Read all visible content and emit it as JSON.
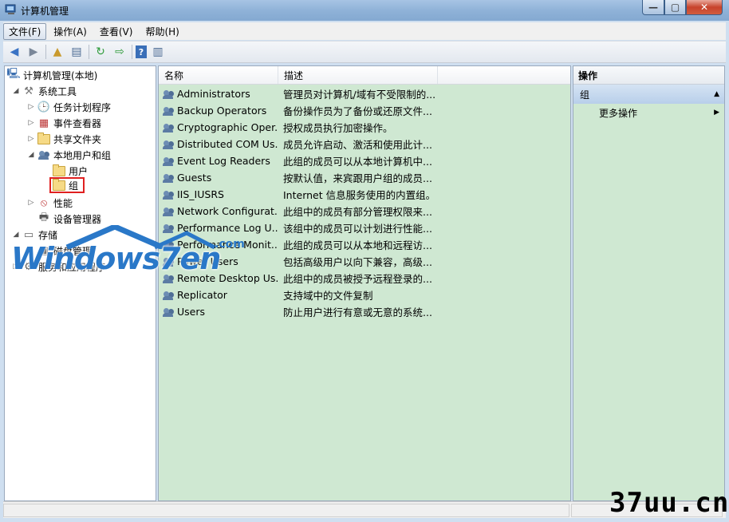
{
  "window": {
    "title": "计算机管理",
    "controls": {
      "min": "—",
      "max": "▢",
      "close": "✕"
    }
  },
  "menubar": [
    {
      "label": "文件(F)"
    },
    {
      "label": "操作(A)"
    },
    {
      "label": "查看(V)"
    },
    {
      "label": "帮助(H)"
    }
  ],
  "tree": {
    "root": "计算机管理(本地)",
    "system_tools": "系统工具",
    "task_scheduler": "任务计划程序",
    "event_viewer": "事件查看器",
    "shared_folders": "共享文件夹",
    "local_users_groups": "本地用户和组",
    "users": "用户",
    "groups": "组",
    "performance": "性能",
    "device_manager": "设备管理器",
    "storage": "存储",
    "disk_management": "磁盘管理",
    "services_apps": "服务和应用程序"
  },
  "list": {
    "columns": [
      "名称",
      "描述"
    ],
    "rows": [
      {
        "name": "Administrators",
        "desc": "管理员对计算机/域有不受限制的..."
      },
      {
        "name": "Backup Operators",
        "desc": "备份操作员为了备份或还原文件..."
      },
      {
        "name": "Cryptographic Oper...",
        "desc": "授权成员执行加密操作。"
      },
      {
        "name": "Distributed COM Us...",
        "desc": "成员允许启动、激活和使用此计..."
      },
      {
        "name": "Event Log Readers",
        "desc": "此组的成员可以从本地计算机中..."
      },
      {
        "name": "Guests",
        "desc": "按默认值，来宾跟用户组的成员..."
      },
      {
        "name": "IIS_IUSRS",
        "desc": "Internet 信息服务使用的内置组。"
      },
      {
        "name": "Network Configurat...",
        "desc": "此组中的成员有部分管理权限来..."
      },
      {
        "name": "Performance Log U...",
        "desc": "该组中的成员可以计划进行性能..."
      },
      {
        "name": "Performance Monit...",
        "desc": "此组的成员可以从本地和远程访..."
      },
      {
        "name": "Power Users",
        "desc": "包括高级用户以向下兼容，高级..."
      },
      {
        "name": "Remote Desktop Us...",
        "desc": "此组中的成员被授予远程登录的..."
      },
      {
        "name": "Replicator",
        "desc": "支持域中的文件复制"
      },
      {
        "name": "Users",
        "desc": "防止用户进行有意或无意的系统..."
      }
    ]
  },
  "actions": {
    "header": "操作",
    "section": "组",
    "more": "更多操作"
  },
  "watermark": {
    "text": "Windows7en",
    "suffix": ".com"
  },
  "site_mark": "37uu.cn",
  "colors": {
    "pane_bg": "#cfe8d2",
    "selection_box": "#e02020"
  }
}
